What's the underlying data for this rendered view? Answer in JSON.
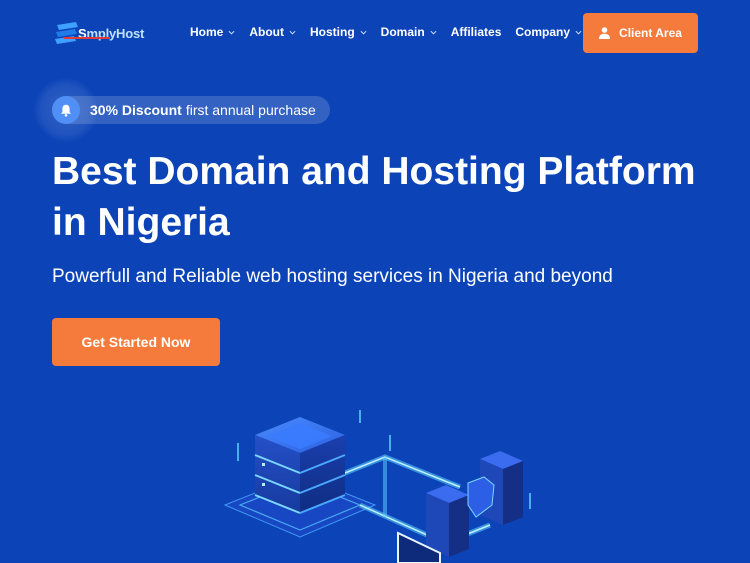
{
  "header": {
    "logo_prefix": "S",
    "logo_text": "mplyHost",
    "nav": [
      {
        "label": "Home",
        "has_dropdown": true
      },
      {
        "label": "About",
        "has_dropdown": true
      },
      {
        "label": "Hosting",
        "has_dropdown": true
      },
      {
        "label": "Domain",
        "has_dropdown": true
      },
      {
        "label": "Affiliates",
        "has_dropdown": false
      },
      {
        "label": "Company",
        "has_dropdown": true
      }
    ],
    "client_area_label": "Client Area"
  },
  "hero": {
    "badge_bold": "30% Discount",
    "badge_text": "first annual purchase",
    "title_line1": "Best Domain and Hosting Platform",
    "title_line2": "in Nigeria",
    "subtitle": "Powerfull and Reliable web hosting services in Nigeria and beyond",
    "cta_label": "Get Started Now"
  },
  "colors": {
    "background": "#0c44b8",
    "accent": "#f47b3c",
    "badge_icon_bg": "#4f8ff6"
  },
  "icons": {
    "logo": "logo-mark-icon",
    "chevron": "chevron-down-icon",
    "user": "user-icon",
    "bell": "bell-icon"
  }
}
